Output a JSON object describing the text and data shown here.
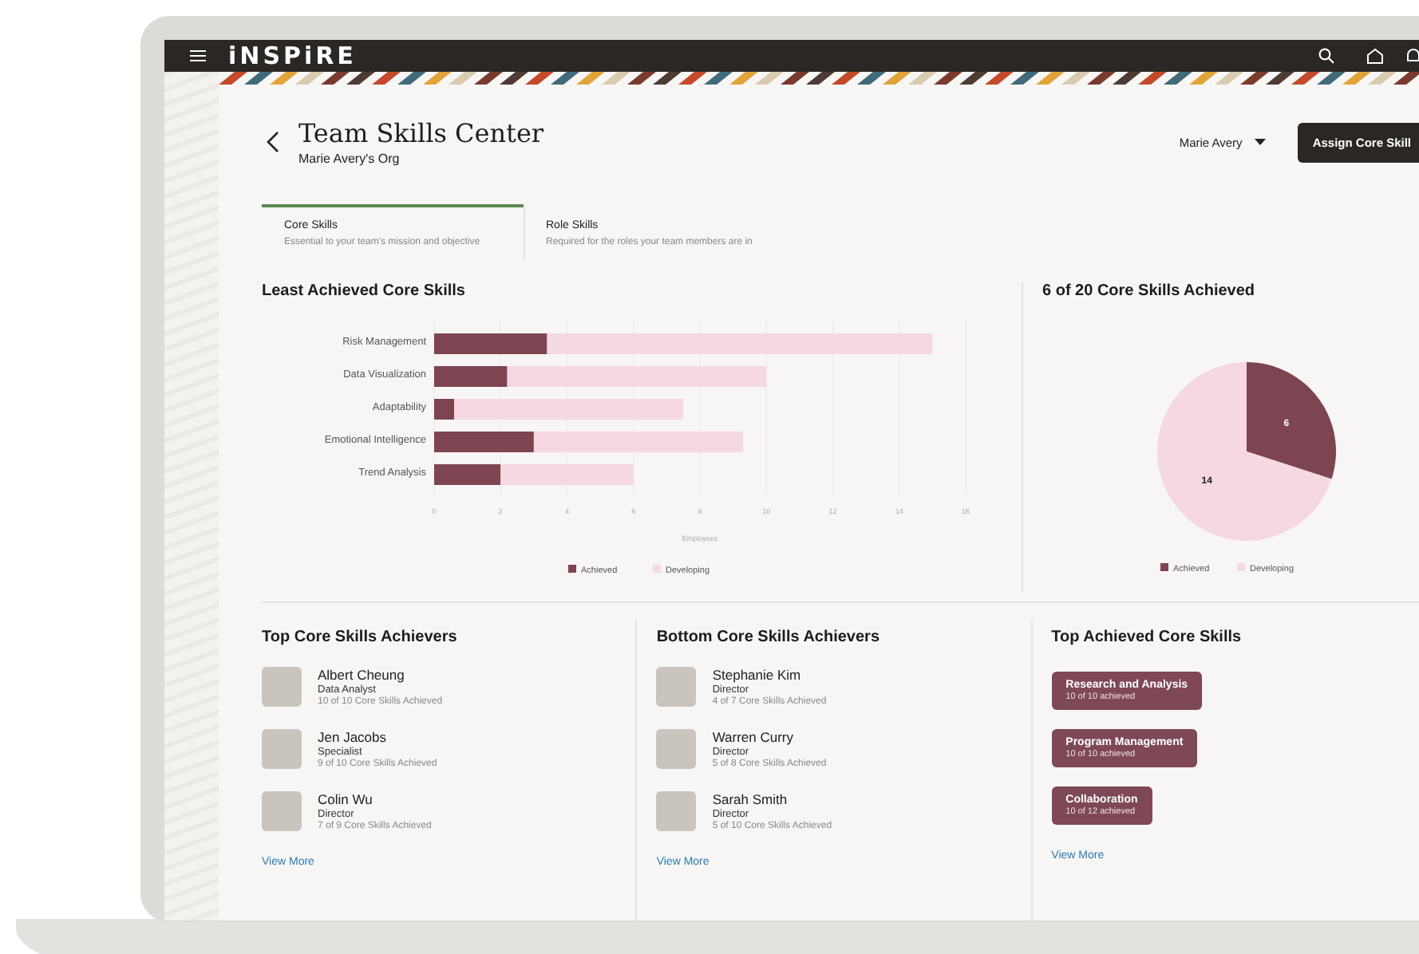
{
  "app_bar": {
    "logo": "iNSPiRE"
  },
  "header": {
    "title": "Team Skills Center",
    "subtitle": "Marie Avery's Org",
    "user_menu": "Marie Avery",
    "primary_button": "Assign Core Skill"
  },
  "tabs": [
    {
      "label": "Core Skills",
      "description": "Essential to your team's mission and objective",
      "selected": true
    },
    {
      "label": "Role Skills",
      "description": "Required for the roles your team members are in",
      "selected": false
    }
  ],
  "bar_panel": {
    "chart_data": {
      "type": "bar",
      "title": "Least Achieved Core Skills",
      "orientation": "horizontal",
      "stacked": true,
      "grid": true,
      "legend": true,
      "xlabel": "Employees",
      "categories": [
        "Risk Management",
        "Data Visualization",
        "Adaptability",
        "Emotional Intelligence",
        "Trend Analysis"
      ],
      "xlim": [
        0,
        16
      ],
      "xticks": [
        0,
        2,
        4,
        6,
        8,
        10,
        12,
        14,
        16
      ],
      "series": [
        {
          "name": "Achieved",
          "color": "#7d4452",
          "values": [
            3.4,
            2.2,
            0.6,
            3.0,
            2.0
          ]
        },
        {
          "name": "Developing",
          "color": "#f6d8e0",
          "values": [
            11.6,
            7.8,
            6.9,
            6.3,
            4.0
          ]
        }
      ]
    }
  },
  "pie_panel": {
    "chart_data": {
      "type": "pie",
      "title": "6 of 20 Core Skills Achieved",
      "categories": [
        "Achieved",
        "Developing"
      ],
      "data_labels": true,
      "legend": true,
      "values": [
        6,
        14
      ],
      "colors": [
        "#7d4452",
        "#f6d8e0"
      ]
    }
  },
  "top_achievers": {
    "title": "Top Core Skills Achievers",
    "people": [
      {
        "name": "Albert Cheung",
        "role": "Data Analyst",
        "progress": "10 of 10 Core Skills Achieved"
      },
      {
        "name": "Jen Jacobs",
        "role": "Specialist",
        "progress": "9 of 10 Core Skills Achieved"
      },
      {
        "name": "Colin Wu",
        "role": "Director",
        "progress": "7 of 9 Core Skills Achieved"
      }
    ],
    "link": "View More"
  },
  "bottom_achievers": {
    "title": "Bottom Core Skills Achievers",
    "people": [
      {
        "name": "Stephanie Kim",
        "role": "Director",
        "progress": "4 of 7 Core Skills Achieved"
      },
      {
        "name": "Warren Curry",
        "role": "Director",
        "progress": "5 of 8 Core Skills Achieved"
      },
      {
        "name": "Sarah Smith",
        "role": "Director",
        "progress": "5 of 10 Core Skills Achieved"
      }
    ],
    "link": "View More"
  },
  "top_skills": {
    "title": "Top Achieved Core Skills",
    "skills": [
      {
        "name": "Research and Analysis",
        "progress": "10 of 10 achieved"
      },
      {
        "name": "Program Management",
        "progress": "10 of 10 achieved"
      },
      {
        "name": "Collaboration",
        "progress": "10 of 12 achieved"
      }
    ],
    "link": "View More"
  }
}
